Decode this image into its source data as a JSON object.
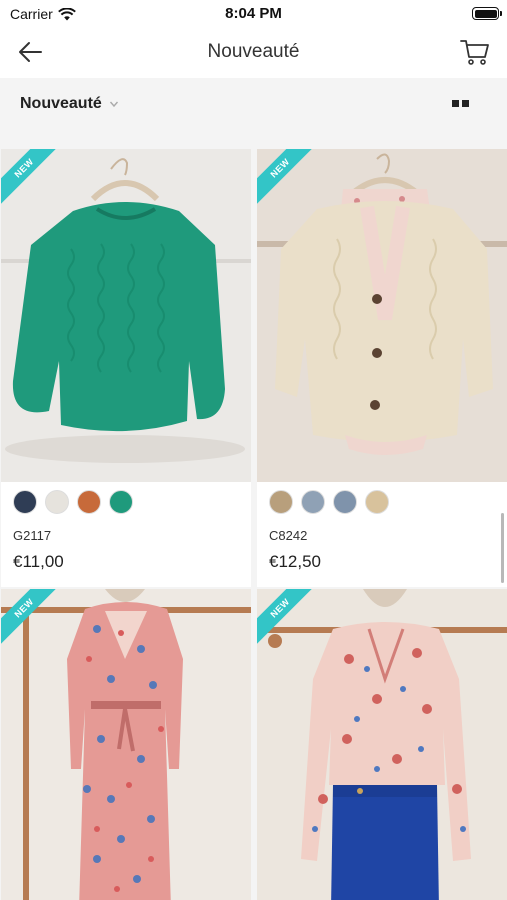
{
  "status_bar": {
    "carrier": "Carrier",
    "time": "8:04 PM"
  },
  "nav": {
    "title": "Nouveauté",
    "back_icon": "arrow-left-icon",
    "cart_icon": "cart-icon"
  },
  "filter": {
    "selected": "Nouveauté",
    "grid_icon": "grid-view-icon"
  },
  "colors": {
    "accent": "#33c5c7",
    "background": "#f4f4f4"
  },
  "products": [
    {
      "badge": "NEW",
      "ref": "G2117",
      "price": "€11,00",
      "swatches": [
        "#2f3d55",
        "#e6e3dd",
        "#c76a3a",
        "#1f9a7c"
      ]
    },
    {
      "badge": "NEW",
      "ref": "C8242",
      "price": "€12,50",
      "swatches": [
        "#b89f7c",
        "#8fa1b5",
        "#7f93ab",
        "#d8c29c"
      ]
    },
    {
      "badge": "NEW"
    },
    {
      "badge": "NEW"
    }
  ]
}
